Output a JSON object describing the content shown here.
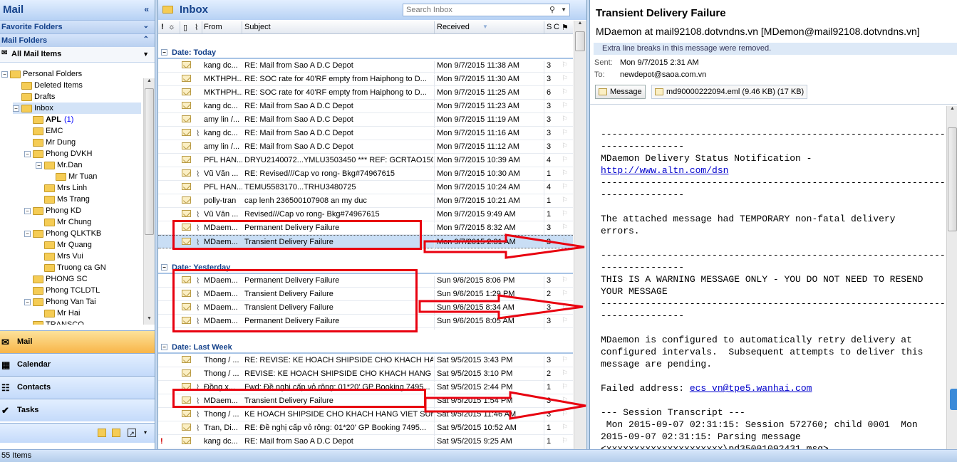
{
  "nav": {
    "title": "Mail",
    "favorite_folders": "Favorite Folders",
    "mail_folders": "Mail Folders",
    "all_mail_items": "All Mail Items",
    "tree": [
      {
        "label": "Personal Folders",
        "level": 0,
        "expander": "−",
        "icon": "personal"
      },
      {
        "label": "Deleted Items",
        "level": 1,
        "icon": "deleted"
      },
      {
        "label": "Drafts",
        "level": 1,
        "icon": "drafts"
      },
      {
        "label": "Inbox",
        "level": 1,
        "expander": "−",
        "selected": true
      },
      {
        "label": "APL",
        "level": 2,
        "count": "(1)",
        "bold": true
      },
      {
        "label": "EMC",
        "level": 2
      },
      {
        "label": "Mr Dung",
        "level": 2
      },
      {
        "label": "Phong DVKH",
        "level": 2,
        "expander": "−"
      },
      {
        "label": "Mr.Dan",
        "level": 3,
        "expander": "−"
      },
      {
        "label": "Mr Tuan",
        "level": 4
      },
      {
        "label": "Mrs Linh",
        "level": 3
      },
      {
        "label": "Ms Trang",
        "level": 3
      },
      {
        "label": "Phong KD",
        "level": 2,
        "expander": "−"
      },
      {
        "label": "Mr Chung",
        "level": 3
      },
      {
        "label": "Phong QLKTKB",
        "level": 2,
        "expander": "−"
      },
      {
        "label": "Mr Quang",
        "level": 3
      },
      {
        "label": "Mrs Vui",
        "level": 3
      },
      {
        "label": "Truong ca GN",
        "level": 3
      },
      {
        "label": "PHONG SC",
        "level": 2
      },
      {
        "label": "Phong TCLDTL",
        "level": 2
      },
      {
        "label": "Phong Van Tai",
        "level": 2,
        "expander": "−"
      },
      {
        "label": "Mr Hai",
        "level": 3
      },
      {
        "label": "TRANSCO",
        "level": 2
      }
    ],
    "buttons": [
      {
        "label": "Mail",
        "icon": "mail-icon",
        "active": true
      },
      {
        "label": "Calendar",
        "icon": "calendar-icon"
      },
      {
        "label": "Contacts",
        "icon": "contacts-icon"
      },
      {
        "label": "Tasks",
        "icon": "tasks-icon"
      }
    ]
  },
  "list": {
    "title": "Inbox",
    "search_placeholder": "Search Inbox",
    "columns": {
      "from": "From",
      "subject": "Subject",
      "received": "Received",
      "size": "S",
      "categories": "C"
    },
    "groups": [
      {
        "label": "Date: Today",
        "rows": [
          {
            "from": "kang dc...",
            "subject": "RE: Mail from Sao A D.C Depot",
            "received": "Mon 9/7/2015 11:38 AM",
            "size": "3"
          },
          {
            "from": "MKTHPH...",
            "subject": "RE: SOC rate for 40'RF empty from Haiphong to D...",
            "received": "Mon 9/7/2015 11:30 AM",
            "size": "3"
          },
          {
            "from": "MKTHPH...",
            "subject": "RE: SOC rate for 40'RF empty from Haiphong to D...",
            "received": "Mon 9/7/2015 11:25 AM",
            "size": "6"
          },
          {
            "from": "kang dc...",
            "subject": "RE: Mail from Sao A D.C Depot",
            "received": "Mon 9/7/2015 11:23 AM",
            "size": "3"
          },
          {
            "from": "amy lin /...",
            "subject": "RE: Mail from Sao A D.C Depot",
            "received": "Mon 9/7/2015 11:19 AM",
            "size": "3"
          },
          {
            "from": "kang dc...",
            "subject": "RE: Mail from Sao A D.C Depot",
            "received": "Mon 9/7/2015 11:16 AM",
            "size": "3",
            "attach": true
          },
          {
            "from": "amy lin /...",
            "subject": "RE: Mail from Sao A D.C Depot",
            "received": "Mon 9/7/2015 11:12 AM",
            "size": "3"
          },
          {
            "from": "PFL HAN...",
            "subject": "DRYU2140072...YMLU3503450 *** REF: GCRTAO150...",
            "received": "Mon 9/7/2015 10:39 AM",
            "size": "4"
          },
          {
            "from": "Vũ Văn ...",
            "subject": "RE: Revised///Cap vo rong- Bkg#74967615",
            "received": "Mon 9/7/2015 10:30 AM",
            "size": "1",
            "attach": true
          },
          {
            "from": "PFL HAN...",
            "subject": "TEMU5583170...TRHU3480725",
            "received": "Mon 9/7/2015 10:24 AM",
            "size": "4"
          },
          {
            "from": "polly-tran",
            "subject": "cap lenh 236500107908 an my duc",
            "received": "Mon 9/7/2015 10:21 AM",
            "size": "1"
          },
          {
            "from": "Vũ Văn ...",
            "subject": "Revised///Cap vo rong- Bkg#74967615",
            "received": "Mon 9/7/2015 9:49 AM",
            "size": "1",
            "attach": true
          },
          {
            "from": "MDaem...",
            "subject": "Permanent Delivery Failure",
            "received": "Mon 9/7/2015 8:32 AM",
            "size": "3",
            "attach": true
          },
          {
            "from": "MDaem...",
            "subject": "Transient Delivery Failure",
            "received": "Mon 9/7/2015 2:31 AM",
            "size": "3",
            "attach": true,
            "selected": true
          }
        ]
      },
      {
        "label": "Date: Yesterday",
        "rows": [
          {
            "from": "MDaem...",
            "subject": "Permanent Delivery Failure",
            "received": "Sun 9/6/2015 8:06 PM",
            "size": "3",
            "attach": true
          },
          {
            "from": "MDaem...",
            "subject": "Transient Delivery Failure",
            "received": "Sun 9/6/2015 1:29 PM",
            "size": "2",
            "attach": true
          },
          {
            "from": "MDaem...",
            "subject": "Transient Delivery Failure",
            "received": "Sun 9/6/2015 8:34 AM",
            "size": "3",
            "attach": true
          },
          {
            "from": "MDaem...",
            "subject": "Permanent Delivery Failure",
            "received": "Sun 9/6/2015 8:05 AM",
            "size": "3",
            "attach": true
          }
        ]
      },
      {
        "label": "Date: Last Week",
        "rows": [
          {
            "from": "Thong / ...",
            "subject": "RE: REVISE: KE HOACH SHIPSIDE CHO KHACH HAN...",
            "received": "Sat 9/5/2015 3:43 PM",
            "size": "3"
          },
          {
            "from": "Thong / ...",
            "subject": "REVISE: KE HOACH SHIPSIDE CHO KHACH HANG VI...",
            "received": "Sat 9/5/2015 3:10 PM",
            "size": "2"
          },
          {
            "from": "Đồng x...",
            "subject": "Fwd: Đề nghị cấp vỏ rỗng: 01*20' GP Booking 7495...",
            "received": "Sat 9/5/2015 2:44 PM",
            "size": "1",
            "attach": true
          },
          {
            "from": "MDaem...",
            "subject": "Transient Delivery Failure",
            "received": "Sat 9/5/2015 1:54 PM",
            "size": "3",
            "attach": true
          },
          {
            "from": "Thong / ...",
            "subject": "KE HOACH SHIPSIDE CHO KHACH HANG VIET SUN",
            "received": "Sat 9/5/2015 11:46 AM",
            "size": "3",
            "attach": true
          },
          {
            "from": "Tran, Di...",
            "subject": "RE: Đề nghị cấp vỏ rỗng: 01*20' GP Booking 7495...",
            "received": "Sat 9/5/2015 10:52 AM",
            "size": "1",
            "attach": true
          },
          {
            "from": "kang dc...",
            "subject": "RE: Mail from Sao A D.C Depot",
            "received": "Sat 9/5/2015 9:25 AM",
            "size": "1",
            "important": true
          }
        ]
      }
    ]
  },
  "reading": {
    "subject": "Transient Delivery Failure",
    "from": "MDaemon at mail92108.dotvndns.vn [MDemon@mail92108.dotvndns.vn]",
    "infobar": "Extra line breaks in this message were removed.",
    "sent_label": "Sent:",
    "sent_value": "Mon 9/7/2015 2:31 AM",
    "to_label": "To:",
    "to_value": "newdepot@saoa.com.vn",
    "att_message": "Message",
    "att_file": "md90000222094.eml (9.46 KB) (17 KB)",
    "body": {
      "dash1": "--------------------------------------------------------------",
      "dash2": "---------------",
      "l_notif": "MDaemon Delivery Status Notification -",
      "link1": "http://www.altn.com/dsn",
      "l_att1": "The attached message had TEMPORARY non-fatal delivery",
      "l_att2": "errors.",
      "l_warn1": "THIS IS A WARNING MESSAGE ONLY - YOU DO NOT NEED TO RESEND",
      "l_warn2": "YOUR MESSAGE",
      "l_cfg1": "MDaemon is configured to automatically retry delivery at",
      "l_cfg2": "configured intervals.  Subsequent attempts to deliver this",
      "l_cfg3": "message are pending.",
      "l_failed": "Failed address: ",
      "link2": "ecs_vn@tpe5.wanhai.com",
      "l_sess": "--- Session Transcript ---",
      "l_t1": " Mon 2015-09-07 02:31:15: Session 572760; child 0001  Mon",
      "l_t2": "2015-09-07 02:31:15: Parsing message",
      "l_t3": "<xxxxxxxxxxxxxxxxxxxxx\\pd35001092431.msg>"
    }
  },
  "status": "55 Items"
}
